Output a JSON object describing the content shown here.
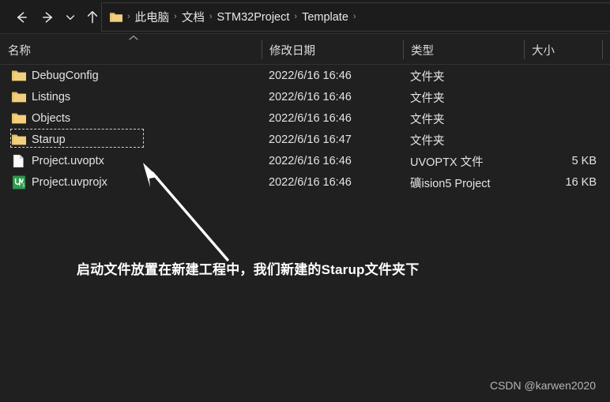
{
  "window": {
    "title": "Template",
    "background_color": "#202020",
    "text_color": "#e3e3e3"
  },
  "navbar": {
    "back_label": "后退",
    "forward_label": "前进",
    "recent_label": "最近使用的位置",
    "up_label": "上移到",
    "breadcrumbs": [
      {
        "label": "此电脑"
      },
      {
        "label": "文档"
      },
      {
        "label": "STM32Project"
      },
      {
        "label": "Template"
      }
    ],
    "separator": "›"
  },
  "columns": [
    {
      "key": "name",
      "label": "名称",
      "sorted": true,
      "sort_indicator": "^"
    },
    {
      "key": "date",
      "label": "修改日期",
      "sorted": false
    },
    {
      "key": "type",
      "label": "类型",
      "sorted": false
    },
    {
      "key": "size",
      "label": "大小",
      "sorted": false
    }
  ],
  "files": [
    {
      "name": "DebugConfig",
      "date": "2022/6/16 16:46",
      "type": "文件夹",
      "size": "",
      "icon": "folder-icon",
      "selected": false
    },
    {
      "name": "Listings",
      "date": "2022/6/16 16:46",
      "type": "文件夹",
      "size": "",
      "icon": "folder-icon",
      "selected": false
    },
    {
      "name": "Objects",
      "date": "2022/6/16 16:46",
      "type": "文件夹",
      "size": "",
      "icon": "folder-icon",
      "selected": false
    },
    {
      "name": "Starup",
      "date": "2022/6/16 16:47",
      "type": "文件夹",
      "size": "",
      "icon": "folder-icon",
      "selected": true
    },
    {
      "name": "Project.uvoptx",
      "date": "2022/6/16 16:46",
      "type": "UVOPTX 文件",
      "size": "5 KB",
      "icon": "blank-document-icon",
      "selected": false
    },
    {
      "name": "Project.uvprojx",
      "date": "2022/6/16 16:46",
      "type": "礦ision5 Project",
      "size": "16 KB",
      "icon": "uvision-project-icon",
      "selected": false
    }
  ],
  "annotations": {
    "note_text": "启动文件放置在新建工程中，我们新建的Starup文件夹下",
    "arrow_label": "arrow-pointing-to-starup-row",
    "arrow_color": "#ffffff"
  },
  "watermark": {
    "text": "CSDN @karwen2020"
  }
}
